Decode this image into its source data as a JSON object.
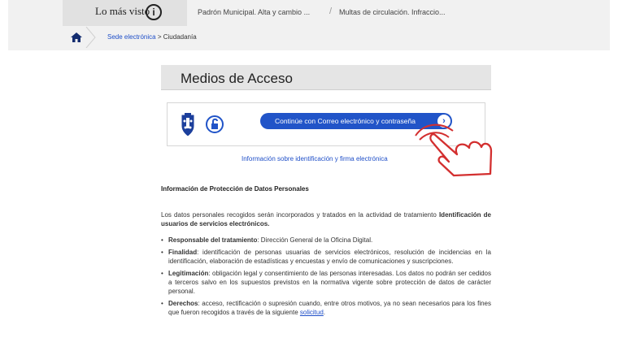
{
  "header": {
    "most_viewed_label": "Lo más visto",
    "info_symbol": "i",
    "quick_links": [
      "Padrón Municipal. Alta y cambio ...",
      "Multas de circulación. Infraccio..."
    ],
    "separator": "/"
  },
  "breadcrumb": {
    "section": "Sede electrónica",
    "separator": ">",
    "current": "Ciudadanía"
  },
  "access": {
    "title": "Medios de Acceso",
    "login_button": "Continúe con Correo electrónico y contraseña",
    "arrow": "›",
    "info_link": "Información sobre identificación y firma electrónica"
  },
  "privacy": {
    "title": "Información de Protección de Datos Personales",
    "intro_text": "Los datos personales recogidos serán incorporados y tratados en la actividad de tratamiento ",
    "intro_bold": "Identificación de usuarios de servicios electrónicos.",
    "items": [
      {
        "label": "Responsable del tratamiento",
        "text": ": Dirección General de la Oficina Digital."
      },
      {
        "label": "Finalidad",
        "text": ": identificación de personas usuarias de servicios electrónicos, resolución de incidencias en la identificación, elaboración de estadísticas y encuestas y envío de comunicaciones y suscripciones."
      },
      {
        "label": "Legitimación",
        "text": ": obligación legal y consentimiento de las personas interesadas. Los datos no podrán ser cedidos a terceros salvo en los supuestos previstos en la normativa vigente sobre protección de datos de carácter personal."
      },
      {
        "label": "Derechos",
        "text": ": acceso, rectificación o supresión cuando, entre otros motivos, ya no sean necesarios para los fines que fueron recogidos a través de la siguiente ",
        "link": "solicitud",
        "after": "."
      }
    ]
  },
  "colors": {
    "accent": "#2154c8",
    "cursor": "#d32f2f",
    "header_band": "#f1f1f1"
  },
  "icons": [
    "info-icon",
    "home-icon",
    "madrid-logo",
    "unlock-icon",
    "arrow-right-icon",
    "hand-cursor-icon"
  ]
}
